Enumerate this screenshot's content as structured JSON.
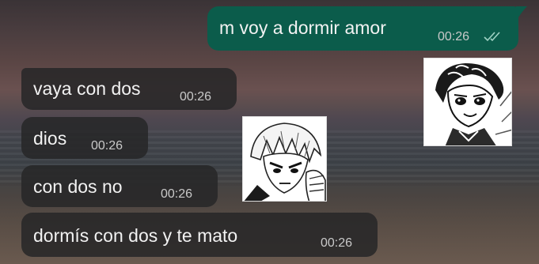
{
  "chat": {
    "messages": [
      {
        "direction": "outgoing",
        "text": "m voy a dormir amor",
        "time": "00:26",
        "status": "read"
      },
      {
        "direction": "incoming",
        "text": "vaya con dos",
        "time": "00:26"
      },
      {
        "direction": "incoming",
        "text": "dios",
        "time": "00:26"
      },
      {
        "direction": "incoming",
        "text": "con dos no",
        "time": "00:26"
      },
      {
        "direction": "incoming",
        "text": "dormís con dos y te mato",
        "time": "00:26"
      }
    ],
    "stickers": [
      {
        "subject": "anime-boy-dark-hair-smiling"
      },
      {
        "subject": "anime-boy-light-hair-frowning"
      }
    ]
  },
  "colors": {
    "outgoing_bubble": "#0b5c4b",
    "incoming_bubble": "#262628",
    "text": "#f2f2f2",
    "timestamp": "#c9c9c9",
    "read_ticks": "#9fd2c4"
  }
}
